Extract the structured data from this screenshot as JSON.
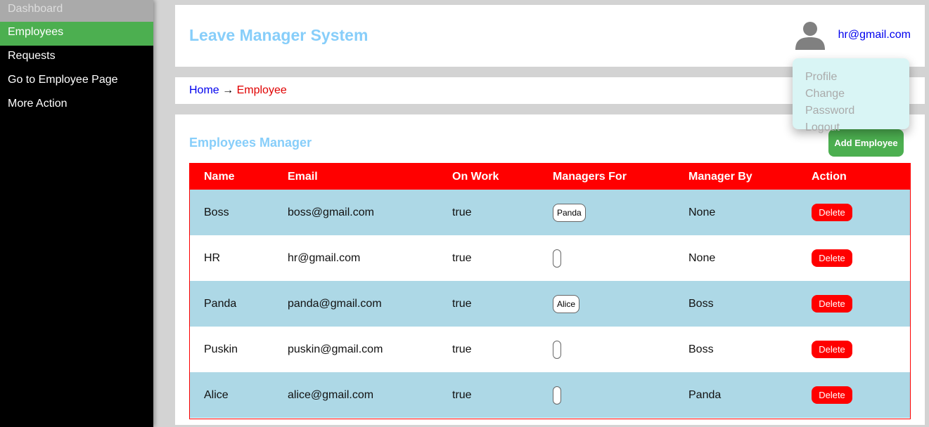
{
  "sidebar": {
    "items": [
      {
        "label": "Dashboard"
      },
      {
        "label": "Employees"
      },
      {
        "label": "Requests"
      },
      {
        "label": "Go to Employee Page"
      },
      {
        "label": "More Action"
      }
    ],
    "active_item": "Employees"
  },
  "header": {
    "title": "Leave Manager System",
    "user_email": "hr@gmail.com",
    "avatar_icon": "user-avatar-icon"
  },
  "user_menu": {
    "items": [
      {
        "label": "Profile"
      },
      {
        "label": "Change Password"
      },
      {
        "label": "Logout"
      }
    ]
  },
  "breadcrumb": {
    "home": "Home",
    "separator": "→",
    "current": "Employee"
  },
  "main": {
    "title": "Employees Manager",
    "add_button_label": "Add Employee",
    "table": {
      "columns": [
        "Name",
        "Email",
        "On Work",
        "Managers For",
        "Manager By",
        "Action"
      ],
      "rows": [
        {
          "name": "Boss",
          "email": "boss@gmail.com",
          "on_work": "true",
          "managers_for": "Panda",
          "manager_by": "None",
          "action": "Delete"
        },
        {
          "name": "HR",
          "email": "hr@gmail.com",
          "on_work": "true",
          "managers_for": "",
          "manager_by": "None",
          "action": "Delete"
        },
        {
          "name": "Panda",
          "email": "panda@gmail.com",
          "on_work": "true",
          "managers_for": "Alice",
          "manager_by": "Boss",
          "action": "Delete"
        },
        {
          "name": "Puskin",
          "email": "puskin@gmail.com",
          "on_work": "true",
          "managers_for": "",
          "manager_by": "Boss",
          "action": "Delete"
        },
        {
          "name": "Alice",
          "email": "alice@gmail.com",
          "on_work": "true",
          "managers_for": "",
          "manager_by": "Panda",
          "action": "Delete"
        }
      ]
    }
  },
  "colors": {
    "sidebar_bg": "#000000",
    "active_item": "#4caf50",
    "title_blue": "#87cefa",
    "table_header": "#ff0000",
    "row_alt": "#add8e6",
    "delete_button": "#ff0000",
    "dropdown_bg": "#d9f5f5"
  }
}
